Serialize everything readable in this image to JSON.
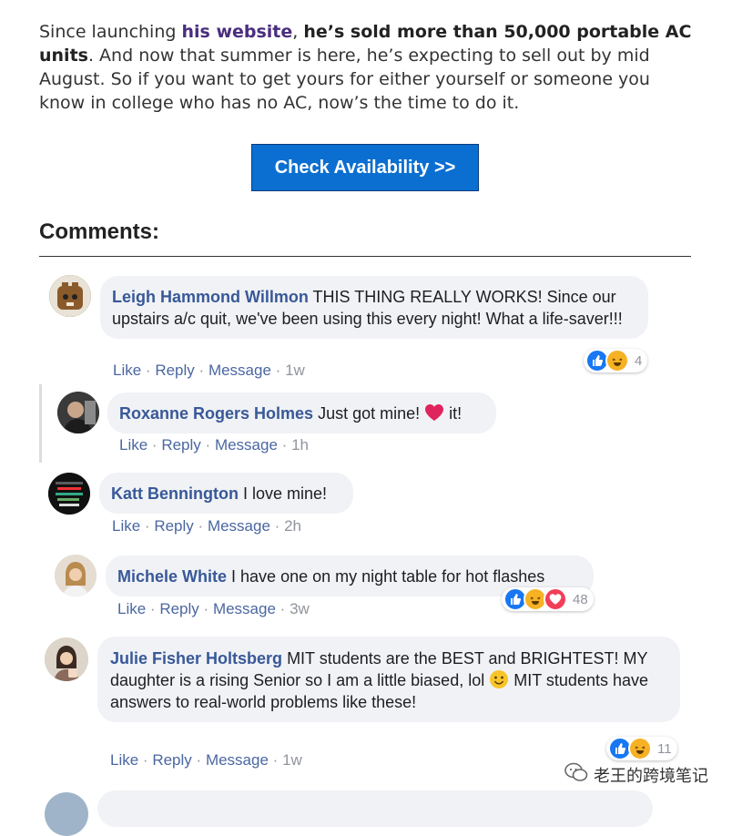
{
  "article": {
    "part1": "Since launching ",
    "link": "his website",
    "part2": ", ",
    "bold": "he’s sold more than 50,000 portable AC units",
    "part3": ". And now that summer is here, he’s expecting to sell out by mid August. So if you want to get yours for either yourself or someone you know in college who has no AC, now’s the time to do it."
  },
  "cta": {
    "label": "Check Availability >>"
  },
  "comments_heading": "Comments:",
  "actions": {
    "like": "Like",
    "reply": "Reply",
    "message": "Message",
    "dot": "·"
  },
  "comments": [
    {
      "name": "Leigh Hammond Willmon",
      "text": "THIS THING REALLY WORKS! Since our upstairs a/c quit, we've been using this every night! What a life-saver!!!",
      "time": "1w",
      "reactions": [
        "like-reaction-icon",
        "haha-reaction-icon"
      ],
      "reaction_count": "4"
    },
    {
      "name": "Roxanne Rogers Holmes",
      "text_before": "Just got mine!",
      "emoji": "heart",
      "text_after": "it!",
      "time": "1h"
    },
    {
      "name": "Katt Bennington",
      "text": "I love mine!",
      "time": "2h"
    },
    {
      "name": "Michele White",
      "text": "I have one on my night table for hot flashes",
      "time": "3w",
      "reactions": [
        "like-reaction-icon",
        "haha-reaction-icon",
        "love-reaction-icon"
      ],
      "reaction_count": "48"
    },
    {
      "name": "Julie Fisher Holtsberg",
      "text_before": "MIT students are the BEST and BRIGHTEST! MY daughter is a rising Senior so I am a little biased, lol",
      "emoji": "slightly-smiling-face",
      "text_after": "MIT students have answers to real-world problems like these!",
      "time": "1w",
      "reactions": [
        "like-reaction-icon",
        "haha-reaction-icon"
      ],
      "reaction_count": "11"
    }
  ],
  "watermark": {
    "text": "老王的跨境笔记",
    "icon": "wechat-icon"
  },
  "colors": {
    "cta": "#0b6fd1",
    "link": "#4a2d7e",
    "name": "#385898",
    "bubble": "#f0f2f5"
  }
}
